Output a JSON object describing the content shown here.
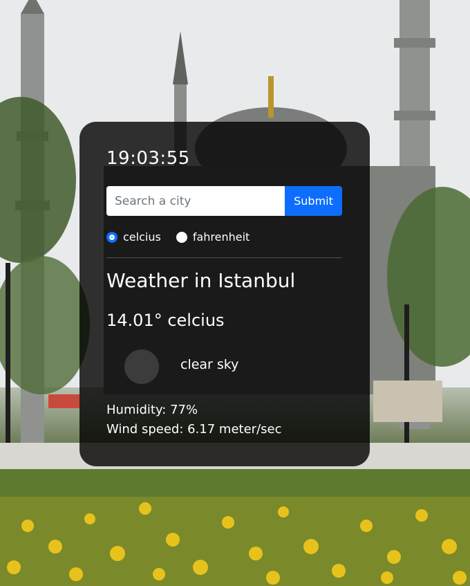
{
  "clock": {
    "time": "19:03:55"
  },
  "search": {
    "placeholder": "Search a city",
    "value": "",
    "submit_label": "Submit"
  },
  "units": {
    "options": [
      {
        "label": "celcius",
        "selected": true
      },
      {
        "label": "fahrenheit",
        "selected": false
      }
    ]
  },
  "weather": {
    "title": "Weather in Istanbul",
    "temperature": "14.01° celcius",
    "description": "clear sky",
    "icon": "clear-sky-icon",
    "humidity": "Humidity: 77%",
    "wind": "Wind speed: 6.17 meter/sec"
  },
  "colors": {
    "accent": "#0d6efd",
    "card_bg": "rgba(0,0,0,0.80)",
    "text": "#ffffff"
  }
}
